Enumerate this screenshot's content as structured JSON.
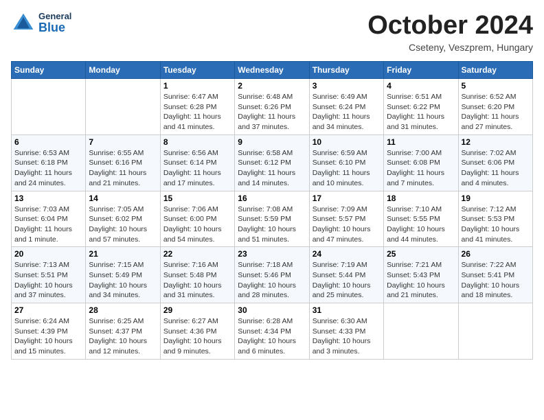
{
  "header": {
    "logo_general": "General",
    "logo_blue": "Blue",
    "month_title": "October 2024",
    "location": "Cseteny, Veszprem, Hungary"
  },
  "calendar": {
    "days_of_week": [
      "Sunday",
      "Monday",
      "Tuesday",
      "Wednesday",
      "Thursday",
      "Friday",
      "Saturday"
    ],
    "weeks": [
      [
        {
          "day": "",
          "info": ""
        },
        {
          "day": "",
          "info": ""
        },
        {
          "day": "1",
          "info": "Sunrise: 6:47 AM\nSunset: 6:28 PM\nDaylight: 11 hours and 41 minutes."
        },
        {
          "day": "2",
          "info": "Sunrise: 6:48 AM\nSunset: 6:26 PM\nDaylight: 11 hours and 37 minutes."
        },
        {
          "day": "3",
          "info": "Sunrise: 6:49 AM\nSunset: 6:24 PM\nDaylight: 11 hours and 34 minutes."
        },
        {
          "day": "4",
          "info": "Sunrise: 6:51 AM\nSunset: 6:22 PM\nDaylight: 11 hours and 31 minutes."
        },
        {
          "day": "5",
          "info": "Sunrise: 6:52 AM\nSunset: 6:20 PM\nDaylight: 11 hours and 27 minutes."
        }
      ],
      [
        {
          "day": "6",
          "info": "Sunrise: 6:53 AM\nSunset: 6:18 PM\nDaylight: 11 hours and 24 minutes."
        },
        {
          "day": "7",
          "info": "Sunrise: 6:55 AM\nSunset: 6:16 PM\nDaylight: 11 hours and 21 minutes."
        },
        {
          "day": "8",
          "info": "Sunrise: 6:56 AM\nSunset: 6:14 PM\nDaylight: 11 hours and 17 minutes."
        },
        {
          "day": "9",
          "info": "Sunrise: 6:58 AM\nSunset: 6:12 PM\nDaylight: 11 hours and 14 minutes."
        },
        {
          "day": "10",
          "info": "Sunrise: 6:59 AM\nSunset: 6:10 PM\nDaylight: 11 hours and 10 minutes."
        },
        {
          "day": "11",
          "info": "Sunrise: 7:00 AM\nSunset: 6:08 PM\nDaylight: 11 hours and 7 minutes."
        },
        {
          "day": "12",
          "info": "Sunrise: 7:02 AM\nSunset: 6:06 PM\nDaylight: 11 hours and 4 minutes."
        }
      ],
      [
        {
          "day": "13",
          "info": "Sunrise: 7:03 AM\nSunset: 6:04 PM\nDaylight: 11 hours and 1 minute."
        },
        {
          "day": "14",
          "info": "Sunrise: 7:05 AM\nSunset: 6:02 PM\nDaylight: 10 hours and 57 minutes."
        },
        {
          "day": "15",
          "info": "Sunrise: 7:06 AM\nSunset: 6:00 PM\nDaylight: 10 hours and 54 minutes."
        },
        {
          "day": "16",
          "info": "Sunrise: 7:08 AM\nSunset: 5:59 PM\nDaylight: 10 hours and 51 minutes."
        },
        {
          "day": "17",
          "info": "Sunrise: 7:09 AM\nSunset: 5:57 PM\nDaylight: 10 hours and 47 minutes."
        },
        {
          "day": "18",
          "info": "Sunrise: 7:10 AM\nSunset: 5:55 PM\nDaylight: 10 hours and 44 minutes."
        },
        {
          "day": "19",
          "info": "Sunrise: 7:12 AM\nSunset: 5:53 PM\nDaylight: 10 hours and 41 minutes."
        }
      ],
      [
        {
          "day": "20",
          "info": "Sunrise: 7:13 AM\nSunset: 5:51 PM\nDaylight: 10 hours and 37 minutes."
        },
        {
          "day": "21",
          "info": "Sunrise: 7:15 AM\nSunset: 5:49 PM\nDaylight: 10 hours and 34 minutes."
        },
        {
          "day": "22",
          "info": "Sunrise: 7:16 AM\nSunset: 5:48 PM\nDaylight: 10 hours and 31 minutes."
        },
        {
          "day": "23",
          "info": "Sunrise: 7:18 AM\nSunset: 5:46 PM\nDaylight: 10 hours and 28 minutes."
        },
        {
          "day": "24",
          "info": "Sunrise: 7:19 AM\nSunset: 5:44 PM\nDaylight: 10 hours and 25 minutes."
        },
        {
          "day": "25",
          "info": "Sunrise: 7:21 AM\nSunset: 5:43 PM\nDaylight: 10 hours and 21 minutes."
        },
        {
          "day": "26",
          "info": "Sunrise: 7:22 AM\nSunset: 5:41 PM\nDaylight: 10 hours and 18 minutes."
        }
      ],
      [
        {
          "day": "27",
          "info": "Sunrise: 6:24 AM\nSunset: 4:39 PM\nDaylight: 10 hours and 15 minutes."
        },
        {
          "day": "28",
          "info": "Sunrise: 6:25 AM\nSunset: 4:37 PM\nDaylight: 10 hours and 12 minutes."
        },
        {
          "day": "29",
          "info": "Sunrise: 6:27 AM\nSunset: 4:36 PM\nDaylight: 10 hours and 9 minutes."
        },
        {
          "day": "30",
          "info": "Sunrise: 6:28 AM\nSunset: 4:34 PM\nDaylight: 10 hours and 6 minutes."
        },
        {
          "day": "31",
          "info": "Sunrise: 6:30 AM\nSunset: 4:33 PM\nDaylight: 10 hours and 3 minutes."
        },
        {
          "day": "",
          "info": ""
        },
        {
          "day": "",
          "info": ""
        }
      ]
    ]
  }
}
